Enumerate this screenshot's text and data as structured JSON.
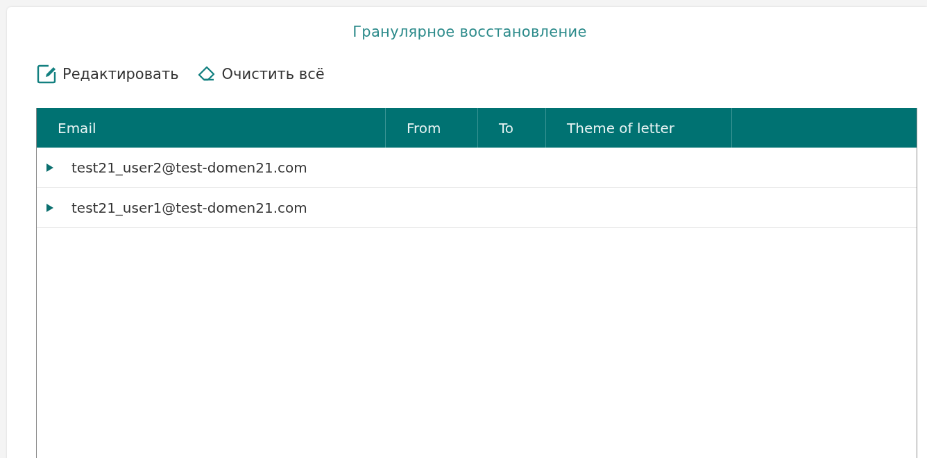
{
  "title": "Гранулярное восстановление",
  "toolbar": [
    {
      "kind": "edit",
      "label": "Редактировать"
    },
    {
      "kind": "clear",
      "label": "Очистить всё"
    }
  ],
  "table": {
    "columns": [
      "Email",
      "From",
      "To",
      "Theme of letter"
    ],
    "rows": [
      {
        "email": "test21_user2@test-domen21.com",
        "expanded": false
      },
      {
        "email": "test21_user1@test-domen21.com",
        "expanded": false
      }
    ]
  }
}
